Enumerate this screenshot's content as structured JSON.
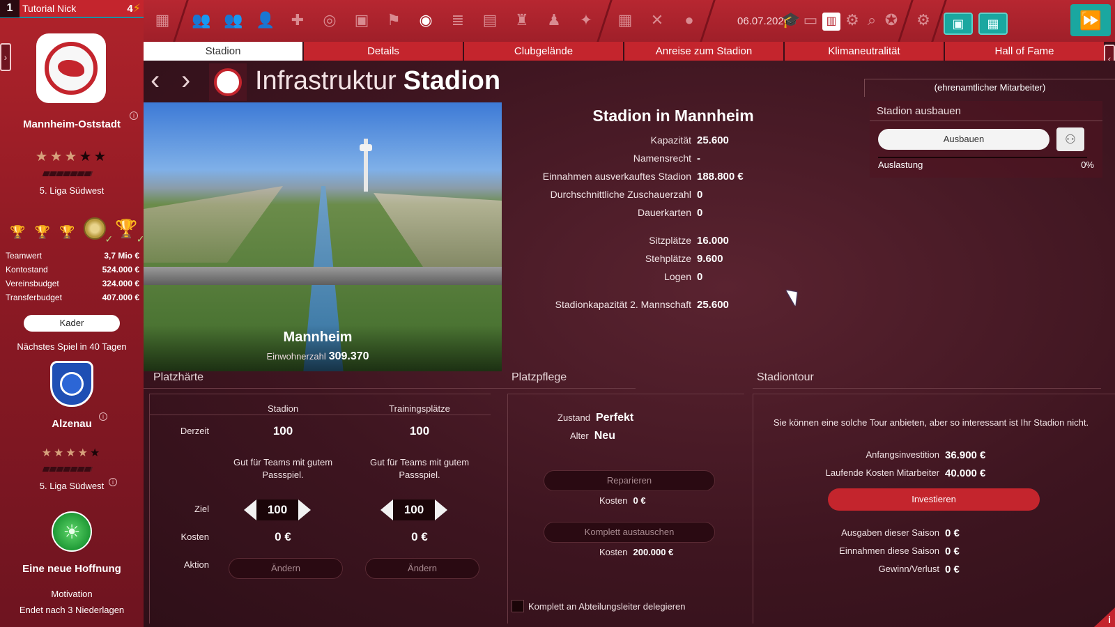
{
  "profile": {
    "rank": "1",
    "name": "Tutorial Nick",
    "energy": "4"
  },
  "club": {
    "name": "Mannheim-Oststadt",
    "stars_on": "★★★",
    "stars_off": "★★",
    "league": "5. Liga Südwest",
    "finances": [
      {
        "label": "Teamwert",
        "value": "3,7 Mio €"
      },
      {
        "label": "Kontostand",
        "value": "524.000 €"
      },
      {
        "label": "Vereinsbudget",
        "value": "324.000 €"
      },
      {
        "label": "Transferbudget",
        "value": "407.000 €"
      }
    ],
    "kader_label": "Kader"
  },
  "next_match": {
    "text": "Nächstes Spiel in 40 Tagen",
    "opponent": "Alzenau",
    "stars_on": "★★★★",
    "stars_off": "★",
    "league": "5. Liga Südwest"
  },
  "motivation": {
    "title": "Eine neue Hoffnung",
    "label": "Motivation",
    "subtitle": "Endet nach 3 Niederlagen"
  },
  "topbar": {
    "date": "06.07.2026"
  },
  "tabs": [
    {
      "label": "Stadion",
      "active": true
    },
    {
      "label": "Details"
    },
    {
      "label": "Clubgelände"
    },
    {
      "label": "Anreise zum Stadion"
    },
    {
      "label": "Klimaneutralität"
    },
    {
      "label": "Hall of Fame"
    }
  ],
  "header": {
    "title_light": "Infrastruktur",
    "title_bold": "Stadion",
    "volunteer": "(ehrenamtlicher Mitarbeiter)"
  },
  "city": {
    "name": "Mannheim",
    "pop_label": "Einwohnerzahl",
    "pop_value": "309.370"
  },
  "stadium": {
    "title": "Stadion in Mannheim",
    "stats": [
      {
        "label": "Kapazität",
        "value": "25.600"
      },
      {
        "label": "Namensrecht",
        "value": "-"
      },
      {
        "label": "Einnahmen ausverkauftes Stadion",
        "value": "188.800 €"
      },
      {
        "label": "Durchschnittliche Zuschauerzahl",
        "value": "0"
      },
      {
        "label": "Dauerkarten",
        "value": "0"
      },
      {
        "label": "Sitzplätze",
        "value": "16.000"
      },
      {
        "label": "Stehplätze",
        "value": "9.600"
      },
      {
        "label": "Logen",
        "value": "0"
      },
      {
        "label": "Stadionkapazität 2. Mannschaft",
        "value": "25.600"
      }
    ]
  },
  "ausbau": {
    "title": "Stadion ausbauen",
    "button": "Ausbauen",
    "auslastung_label": "Auslastung",
    "auslastung_value": "0%",
    "auslastung_pct": 0
  },
  "platzhaerte": {
    "title": "Platzhärte",
    "col_stadion": "Stadion",
    "col_training": "Trainingsplätze",
    "row_derzeit": "Derzeit",
    "row_ziel": "Ziel",
    "row_kosten": "Kosten",
    "row_aktion": "Aktion",
    "stadion_current": "100",
    "training_current": "100",
    "stadion_desc": "Gut für Teams mit gutem Passspiel.",
    "training_desc": "Gut für Teams mit gutem Passspiel.",
    "stadion_target": "100",
    "training_target": "100",
    "stadion_cost": "0 €",
    "training_cost": "0 €",
    "change_label": "Ändern"
  },
  "platzpflege": {
    "title": "Platzpflege",
    "zustand_label": "Zustand",
    "zustand_value": "Perfekt",
    "alter_label": "Alter",
    "alter_value": "Neu",
    "repair_label": "Reparieren",
    "repair_cost_label": "Kosten",
    "repair_cost": "0 €",
    "replace_label": "Komplett austauschen",
    "replace_cost_label": "Kosten",
    "replace_cost": "200.000 €",
    "delegate_label": "Komplett an Abteilungsleiter delegieren"
  },
  "stadiontour": {
    "title": "Stadiontour",
    "message": "Sie können eine solche Tour anbieten, aber so interessant ist Ihr Stadion nicht.",
    "rows": [
      {
        "label": "Anfangsinvestition",
        "value": "36.900 €"
      },
      {
        "label": "Laufende Kosten Mitarbeiter",
        "value": "40.000 €"
      }
    ],
    "invest_label": "Investieren",
    "season_rows": [
      {
        "label": "Ausgaben dieser Saison",
        "value": "0 €"
      },
      {
        "label": "Einnahmen diese Saison",
        "value": "0 €"
      },
      {
        "label": "Gewinn/Verlust",
        "value": "0 €"
      }
    ]
  }
}
